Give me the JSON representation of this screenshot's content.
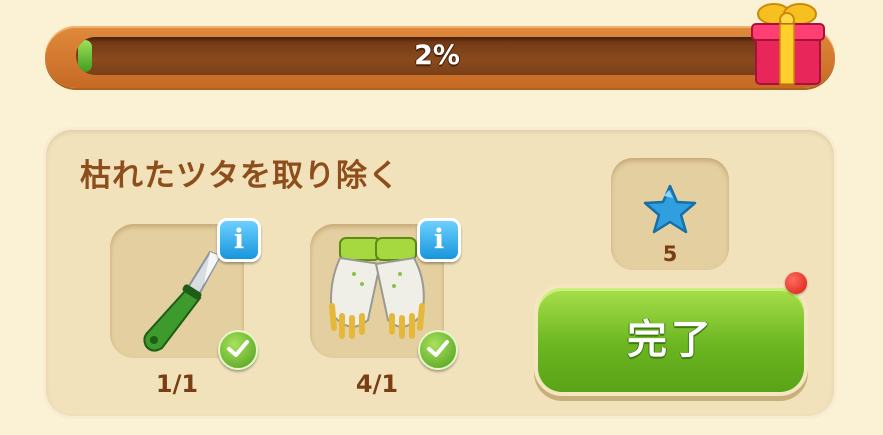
{
  "progress": {
    "percent_text": "2%",
    "fraction": 0.02
  },
  "task": {
    "title": "枯れたツタを取り除く",
    "items": [
      {
        "icon": "garden-knife-icon",
        "count": "1/1",
        "completed": true
      },
      {
        "icon": "gardening-gloves-icon",
        "count": "4/1",
        "completed": true
      }
    ],
    "reward": {
      "icon": "blue-star-icon",
      "count": "5"
    },
    "complete_label": "完了"
  },
  "colors": {
    "progress_fill": "#4fae22",
    "button_green": "#6bb621",
    "title_brown": "#8d4e1b",
    "info_blue": "#1796dc",
    "notification_red": "#e0281c"
  }
}
